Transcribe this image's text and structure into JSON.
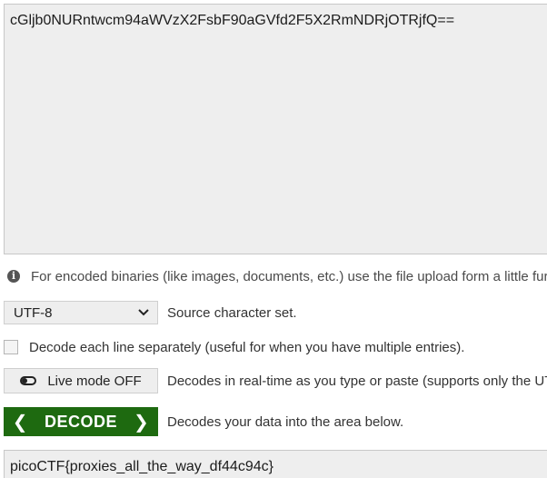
{
  "input": {
    "value": "cGljb0NURntwcm94aWVzX2FsbF90aGVfd2F5X2RmNDRjOTRjfQ=="
  },
  "info": {
    "text": "For encoded binaries (like images, documents, etc.) use the file upload form a little fur"
  },
  "charset": {
    "selected": "UTF-8",
    "description": "Source character set."
  },
  "decode_each_line": {
    "checked": false,
    "label": "Decode each line separately (useful for when you have multiple entries)."
  },
  "live_mode": {
    "label": "Live mode OFF",
    "description": "Decodes in real-time as you type or paste (supports only the UT"
  },
  "decode": {
    "label": "DECODE",
    "description": "Decodes your data into the area below.",
    "color": "#1e6a10"
  },
  "output": {
    "value": "picoCTF{proxies_all_the_way_df44c94c}"
  }
}
